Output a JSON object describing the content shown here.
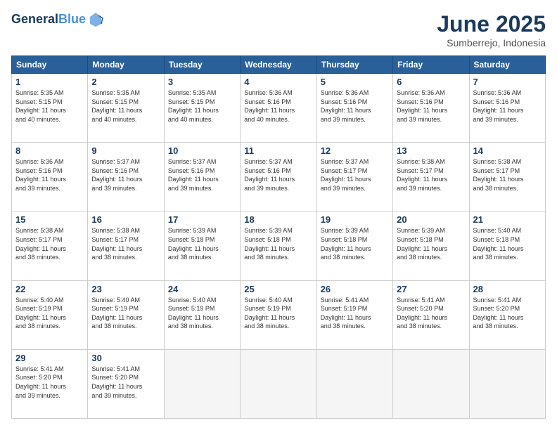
{
  "header": {
    "logo_line1": "General",
    "logo_line2": "Blue",
    "title": "June 2025",
    "location": "Sumberrejo, Indonesia"
  },
  "weekdays": [
    "Sunday",
    "Monday",
    "Tuesday",
    "Wednesday",
    "Thursday",
    "Friday",
    "Saturday"
  ],
  "weeks": [
    [
      {
        "day": "1",
        "info": "Sunrise: 5:35 AM\nSunset: 5:15 PM\nDaylight: 11 hours\nand 40 minutes."
      },
      {
        "day": "2",
        "info": "Sunrise: 5:35 AM\nSunset: 5:15 PM\nDaylight: 11 hours\nand 40 minutes."
      },
      {
        "day": "3",
        "info": "Sunrise: 5:35 AM\nSunset: 5:15 PM\nDaylight: 11 hours\nand 40 minutes."
      },
      {
        "day": "4",
        "info": "Sunrise: 5:36 AM\nSunset: 5:16 PM\nDaylight: 11 hours\nand 40 minutes."
      },
      {
        "day": "5",
        "info": "Sunrise: 5:36 AM\nSunset: 5:16 PM\nDaylight: 11 hours\nand 39 minutes."
      },
      {
        "day": "6",
        "info": "Sunrise: 5:36 AM\nSunset: 5:16 PM\nDaylight: 11 hours\nand 39 minutes."
      },
      {
        "day": "7",
        "info": "Sunrise: 5:36 AM\nSunset: 5:16 PM\nDaylight: 11 hours\nand 39 minutes."
      }
    ],
    [
      {
        "day": "8",
        "info": "Sunrise: 5:36 AM\nSunset: 5:16 PM\nDaylight: 11 hours\nand 39 minutes."
      },
      {
        "day": "9",
        "info": "Sunrise: 5:37 AM\nSunset: 5:16 PM\nDaylight: 11 hours\nand 39 minutes."
      },
      {
        "day": "10",
        "info": "Sunrise: 5:37 AM\nSunset: 5:16 PM\nDaylight: 11 hours\nand 39 minutes."
      },
      {
        "day": "11",
        "info": "Sunrise: 5:37 AM\nSunset: 5:16 PM\nDaylight: 11 hours\nand 39 minutes."
      },
      {
        "day": "12",
        "info": "Sunrise: 5:37 AM\nSunset: 5:17 PM\nDaylight: 11 hours\nand 39 minutes."
      },
      {
        "day": "13",
        "info": "Sunrise: 5:38 AM\nSunset: 5:17 PM\nDaylight: 11 hours\nand 39 minutes."
      },
      {
        "day": "14",
        "info": "Sunrise: 5:38 AM\nSunset: 5:17 PM\nDaylight: 11 hours\nand 38 minutes."
      }
    ],
    [
      {
        "day": "15",
        "info": "Sunrise: 5:38 AM\nSunset: 5:17 PM\nDaylight: 11 hours\nand 38 minutes."
      },
      {
        "day": "16",
        "info": "Sunrise: 5:38 AM\nSunset: 5:17 PM\nDaylight: 11 hours\nand 38 minutes."
      },
      {
        "day": "17",
        "info": "Sunrise: 5:39 AM\nSunset: 5:18 PM\nDaylight: 11 hours\nand 38 minutes."
      },
      {
        "day": "18",
        "info": "Sunrise: 5:39 AM\nSunset: 5:18 PM\nDaylight: 11 hours\nand 38 minutes."
      },
      {
        "day": "19",
        "info": "Sunrise: 5:39 AM\nSunset: 5:18 PM\nDaylight: 11 hours\nand 38 minutes."
      },
      {
        "day": "20",
        "info": "Sunrise: 5:39 AM\nSunset: 5:18 PM\nDaylight: 11 hours\nand 38 minutes."
      },
      {
        "day": "21",
        "info": "Sunrise: 5:40 AM\nSunset: 5:18 PM\nDaylight: 11 hours\nand 38 minutes."
      }
    ],
    [
      {
        "day": "22",
        "info": "Sunrise: 5:40 AM\nSunset: 5:19 PM\nDaylight: 11 hours\nand 38 minutes."
      },
      {
        "day": "23",
        "info": "Sunrise: 5:40 AM\nSunset: 5:19 PM\nDaylight: 11 hours\nand 38 minutes."
      },
      {
        "day": "24",
        "info": "Sunrise: 5:40 AM\nSunset: 5:19 PM\nDaylight: 11 hours\nand 38 minutes."
      },
      {
        "day": "25",
        "info": "Sunrise: 5:40 AM\nSunset: 5:19 PM\nDaylight: 11 hours\nand 38 minutes."
      },
      {
        "day": "26",
        "info": "Sunrise: 5:41 AM\nSunset: 5:19 PM\nDaylight: 11 hours\nand 38 minutes."
      },
      {
        "day": "27",
        "info": "Sunrise: 5:41 AM\nSunset: 5:20 PM\nDaylight: 11 hours\nand 38 minutes."
      },
      {
        "day": "28",
        "info": "Sunrise: 5:41 AM\nSunset: 5:20 PM\nDaylight: 11 hours\nand 38 minutes."
      }
    ],
    [
      {
        "day": "29",
        "info": "Sunrise: 5:41 AM\nSunset: 5:20 PM\nDaylight: 11 hours\nand 39 minutes."
      },
      {
        "day": "30",
        "info": "Sunrise: 5:41 AM\nSunset: 5:20 PM\nDaylight: 11 hours\nand 39 minutes."
      },
      {
        "day": "",
        "info": ""
      },
      {
        "day": "",
        "info": ""
      },
      {
        "day": "",
        "info": ""
      },
      {
        "day": "",
        "info": ""
      },
      {
        "day": "",
        "info": ""
      }
    ]
  ]
}
